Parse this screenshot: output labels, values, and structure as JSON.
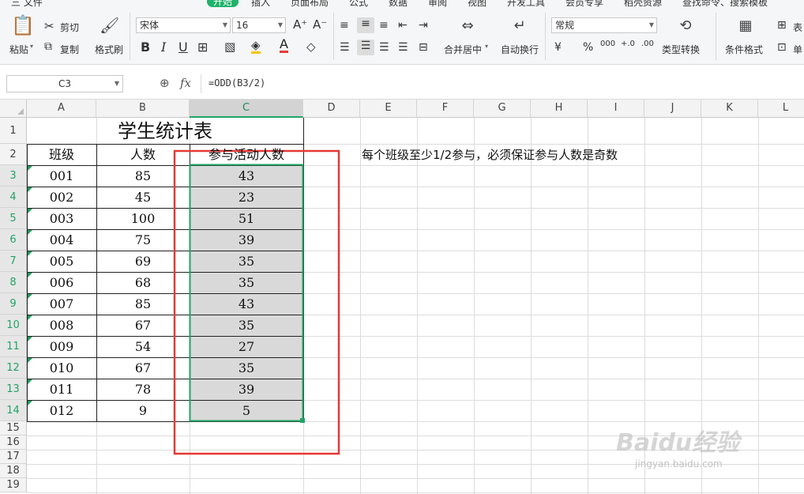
{
  "menu": [
    "三 文件",
    "开始",
    "插入",
    "页面布局",
    "公式",
    "数据",
    "审阅",
    "视图",
    "开发工具",
    "会员专享",
    "稻壳资源",
    "查找命令、搜索模板"
  ],
  "ribbon": {
    "paste": "粘贴",
    "cut": "剪切",
    "copy": "复制",
    "format_painter": "格式刷",
    "font_name": "宋体",
    "font_size": "16",
    "merge_center": "合并居中",
    "wrap_text": "自动换行",
    "number_format": "常规",
    "type_convert": "类型转换",
    "cond_format": "条件格式",
    "table_style": "表",
    "single": "单",
    "currency": "¥",
    "percent": "%",
    "thousands": "000",
    "inc_dec": "+.0",
    "dec_dec": ".00"
  },
  "formula_bar": {
    "cell_ref": "C3",
    "fx": "fx",
    "formula": "=ODD(B3/2)"
  },
  "columns": [
    "A",
    "B",
    "C",
    "D",
    "E",
    "F",
    "G",
    "H",
    "I",
    "J",
    "K",
    "L"
  ],
  "rows": [
    "1",
    "2",
    "3",
    "4",
    "5",
    "6",
    "7",
    "8",
    "9",
    "10",
    "11",
    "12",
    "13",
    "14",
    "15",
    "16",
    "17",
    "18",
    "19"
  ],
  "sheet": {
    "title": "学生统计表",
    "headers": [
      "班级",
      "人数",
      "参与活动人数"
    ],
    "note": "每个班级至少1/2参与，必须保证参与人数是奇数",
    "data": [
      [
        "001",
        "85",
        "43"
      ],
      [
        "002",
        "45",
        "23"
      ],
      [
        "003",
        "100",
        "51"
      ],
      [
        "004",
        "75",
        "39"
      ],
      [
        "005",
        "69",
        "35"
      ],
      [
        "006",
        "68",
        "35"
      ],
      [
        "007",
        "85",
        "43"
      ],
      [
        "008",
        "67",
        "35"
      ],
      [
        "009",
        "54",
        "27"
      ],
      [
        "010",
        "67",
        "35"
      ],
      [
        "011",
        "78",
        "39"
      ],
      [
        "012",
        "9",
        "5"
      ]
    ]
  },
  "watermark": {
    "brand": "Baidu经验",
    "url": "jingyan.baidu.com"
  },
  "colors": {
    "accent": "#21a366",
    "annotation_box": "#e53935",
    "selected_fill": "#d9d9d9"
  }
}
